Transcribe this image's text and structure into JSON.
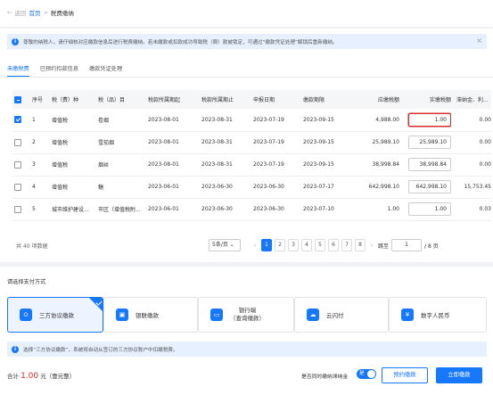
{
  "breadcrumb": {
    "back": "返回",
    "home": "首页",
    "sep": ">",
    "current": "税费缴纳"
  },
  "notice": {
    "text": "尊敬的纳税人，请仔细核对应缴款信息后进行税费缴纳。若未缴款或扣款成功导致税（费）款被锁定，可通过“缴款凭证处理”解锁后重新缴纳。",
    "close": "×"
  },
  "tabs": [
    {
      "label": "未缴税费",
      "active": true
    },
    {
      "label": "已预约扣款信息",
      "active": false
    },
    {
      "label": "缴款凭证处理",
      "active": false
    }
  ],
  "table": {
    "headers": [
      "",
      "序号",
      "税（费）种",
      "税（品）目",
      "税款所属期起",
      "税款所属期止",
      "申报日期",
      "缴款期限",
      "应缴税额",
      "实缴税额",
      "滞纳金、利..."
    ],
    "rows": [
      {
        "checked": true,
        "no": "1",
        "tax": "增值税",
        "item": "卷烟",
        "start": "2023-08-01",
        "end": "2023-08-31",
        "declare": "2023-07-19",
        "deadline": "2023-09-15",
        "due": "4,988.00",
        "paid": "1.00",
        "late": "0.00"
      },
      {
        "checked": false,
        "no": "2",
        "tax": "增值税",
        "item": "雪茄烟",
        "start": "2023-08-01",
        "end": "2023-08-31",
        "declare": "2023-07-19",
        "deadline": "2023-09-15",
        "due": "25,989.10",
        "paid": "25,989.10",
        "late": "0.00"
      },
      {
        "checked": false,
        "no": "3",
        "tax": "增值税",
        "item": "烟丝",
        "start": "2023-08-01",
        "end": "2023-08-31",
        "declare": "2023-07-19",
        "deadline": "2023-09-15",
        "due": "38,998.84",
        "paid": "38,998.84",
        "late": "0.00"
      },
      {
        "checked": false,
        "no": "4",
        "tax": "增值税",
        "item": "糖",
        "start": "2023-06-01",
        "end": "2023-06-30",
        "declare": "2023-06-30",
        "deadline": "2023-07-17",
        "due": "642,998.10",
        "paid": "642,998.10",
        "late": "15,753.45"
      },
      {
        "checked": false,
        "no": "5",
        "tax": "城市维护建设...",
        "item": "市区（增值税附...",
        "start": "2023-06-01",
        "end": "2023-06-30",
        "declare": "2023-06-30",
        "deadline": "2023-07-10",
        "due": "1.00",
        "paid": "1.00",
        "late": "0.03"
      }
    ]
  },
  "pagination": {
    "total": "共 40 项数据",
    "page_size": "5条/页",
    "pages": [
      "1",
      "2",
      "3",
      "4",
      "5",
      "6",
      "7",
      "8"
    ],
    "current": "1",
    "prev": "‹",
    "next": "›",
    "jump_label": "跳至",
    "jump_value": "1",
    "total_pages": "/ 8 页"
  },
  "payment": {
    "title": "请选择支付方式",
    "options": [
      {
        "label": "三方协议缴款",
        "selected": true,
        "icon": "bank-agreement-icon"
      },
      {
        "label": "银联缴款",
        "selected": false,
        "icon": "unionpay-icon"
      },
      {
        "label1": "银行端",
        "label2": "（查询缴款）",
        "selected": false,
        "icon": "bank-card-icon"
      },
      {
        "label": "云闪付",
        "selected": false,
        "icon": "cloud-pay-icon"
      },
      {
        "label": "数字人民币",
        "selected": false,
        "icon": "digital-rmb-icon"
      }
    ],
    "note": "选择“三方协议缴款”，系统将自动从签订的三方协议账户中扣缴税费。"
  },
  "footer": {
    "total_label": "合计",
    "amount": "1.00",
    "unit": "元（壹元整）",
    "credit_label": "是否同时缴纳滞纳金",
    "toggle": "是",
    "reserve": "预约缴款",
    "pay": "立即缴款"
  },
  "colors": {
    "accent": "#1677ff",
    "error": "#d32f2f"
  }
}
